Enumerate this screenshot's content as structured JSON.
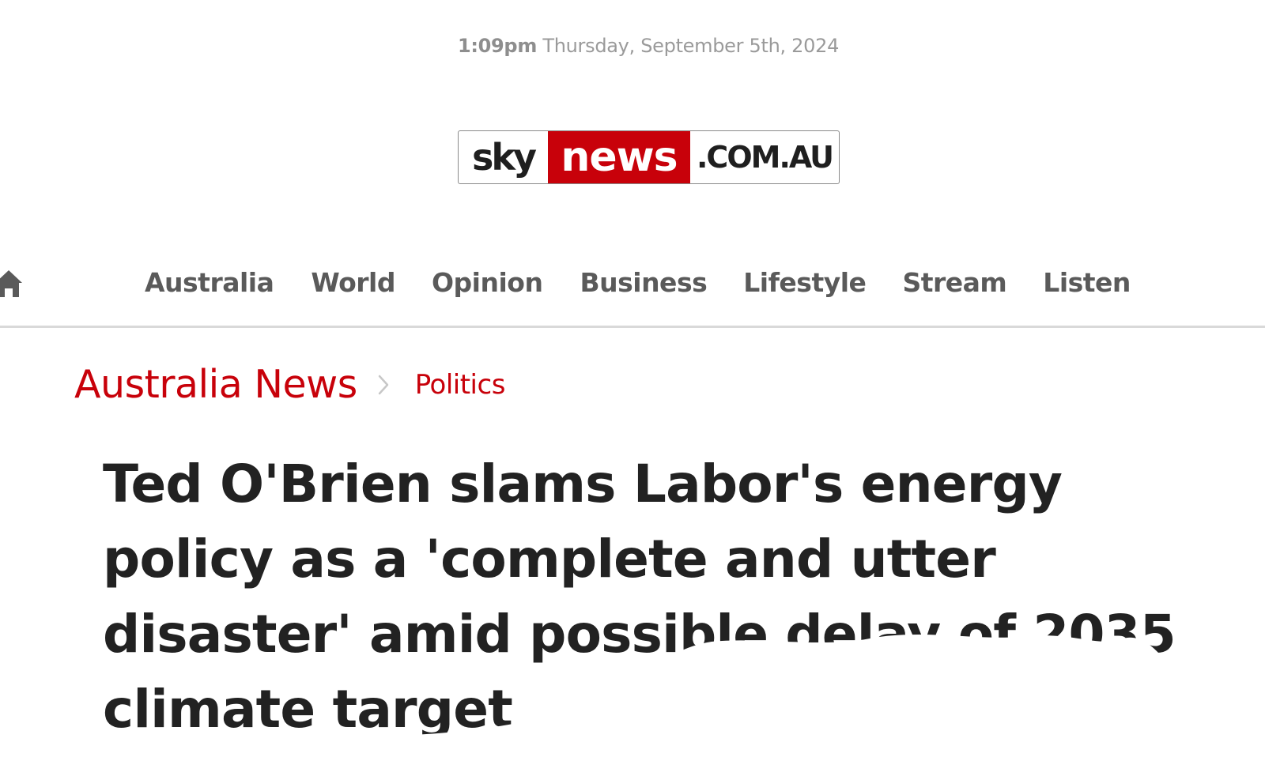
{
  "header": {
    "time": "1:09pm",
    "date": "Thursday, September 5th, 2024"
  },
  "logo": {
    "sky": "sky",
    "news": "news",
    "domain": ".COM.AU",
    "brand_red": "#c8010a"
  },
  "nav": {
    "home_icon": "home-icon",
    "items": [
      "Australia",
      "World",
      "Opinion",
      "Business",
      "Lifestyle",
      "Stream",
      "Listen"
    ]
  },
  "breadcrumb": {
    "section": "Australia News",
    "separator_icon": "chevron-right-icon",
    "subsection": "Politics"
  },
  "article": {
    "headline": "Ted O'Brien slams Labor's energy policy as a 'complete and utter disaster' amid possible delay of 2035 climate target"
  },
  "colors": {
    "accent": "#c8010a",
    "nav_text": "#5a5a5a",
    "headline_text": "#222222",
    "muted": "#9a9a9a"
  }
}
